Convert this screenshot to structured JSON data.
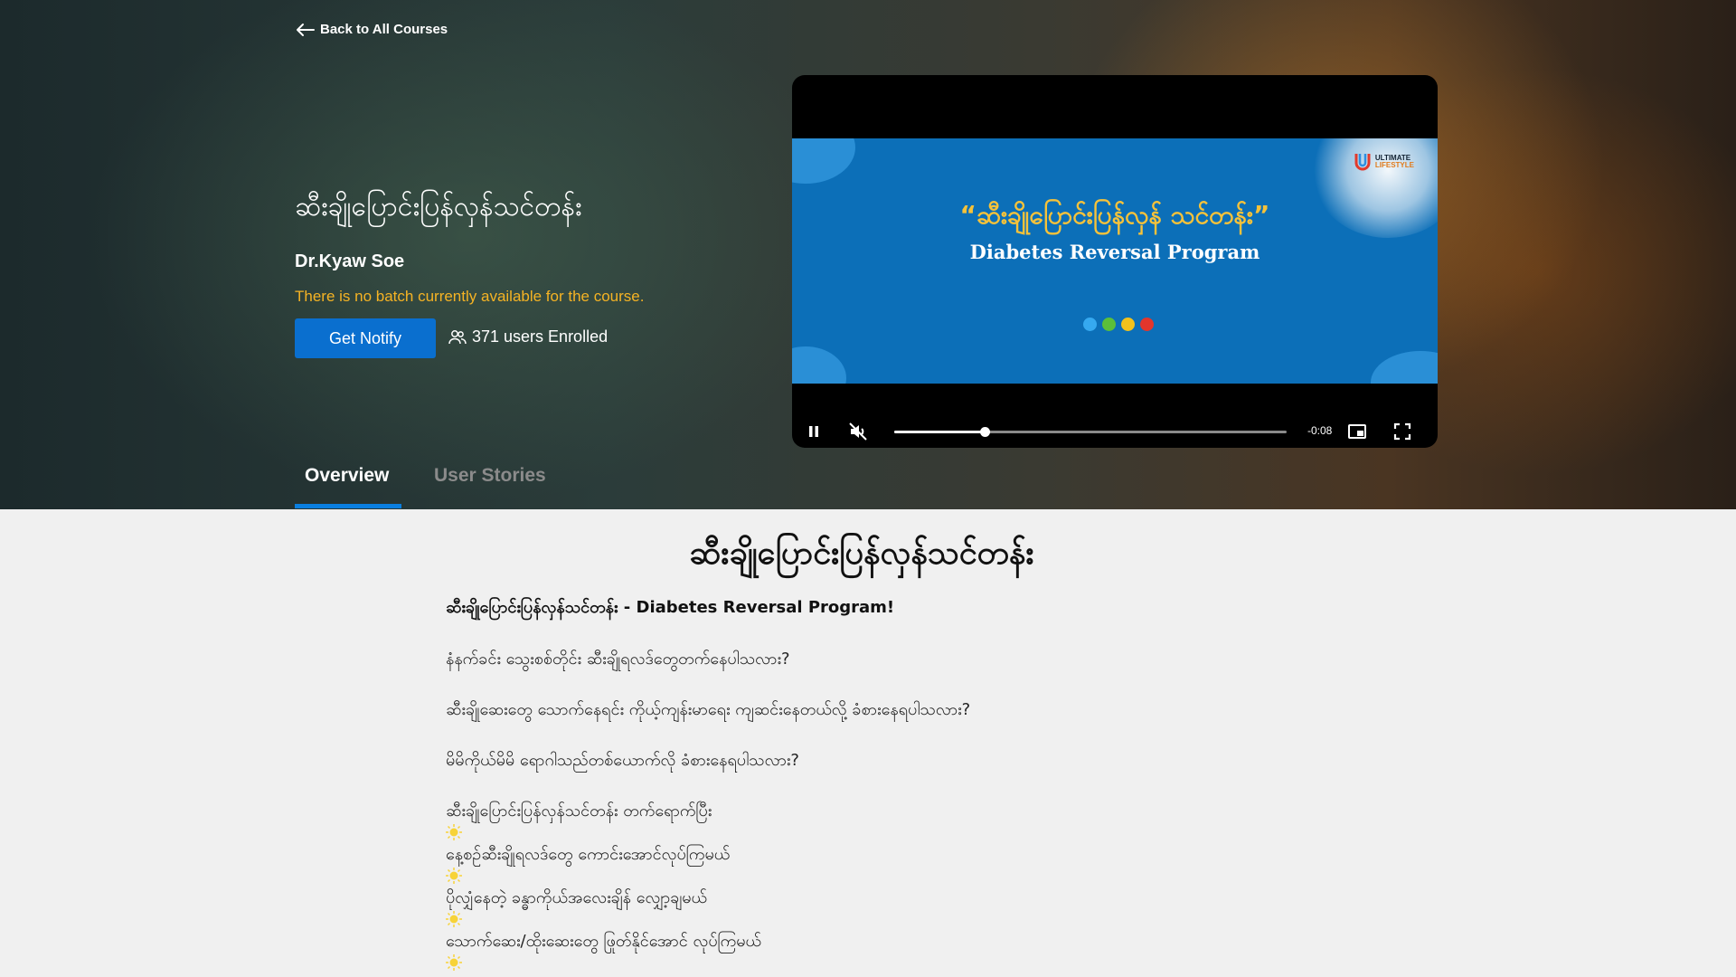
{
  "header": {
    "back_label": "Back to All Courses"
  },
  "course": {
    "title": "ဆီးချိုပြောင်းပြန်လှန်သင်တန်း",
    "instructor": "Dr.Kyaw Soe",
    "batch_note": "There is no batch currently available for the course.",
    "notify_label": "Get Notify",
    "enrolled_text": "371 users Enrolled"
  },
  "video": {
    "slide_title_my": "“ဆီးချိုပြောင်းပြန်လှန် သင်တန်း”",
    "slide_title_en": "Diabetes Reversal Program",
    "logo_text_top": "ULTIMATE",
    "logo_text_bottom": "LIFESTYLE",
    "time_remaining": "-0:08",
    "progress_fraction": 0.23,
    "dot_colors": [
      "#36a9f0",
      "#5bbf3a",
      "#f2c21b",
      "#e2362c"
    ]
  },
  "tabs": [
    {
      "label": "Overview",
      "active": true
    },
    {
      "label": "User Stories",
      "active": false
    }
  ],
  "content": {
    "heading": "ဆီးချိုပြောင်းပြန်လှန်သင်တန်း",
    "subtitle": "ဆီးချိုပြောင်းပြန်လှန်သင်တန်း - Diabetes Reversal Program!",
    "paragraphs": [
      "နံနက်ခင်း သွေးစစ်တိုင်း ဆီးချိုရလဒ်တွေတက်နေပါသလား?",
      "ဆီးချိုဆေးတွေ သောက်နေရင်း ကိုယ့်ကျန်းမာရေး ကျဆင်းနေတယ်လို့ ခံစားနေရပါသလား?",
      "မိမိကိုယ်မိမိ ရောဂါသည်တစ်ယောက်လို ခံစားနေရပါသလား?"
    ],
    "intro_line": "ဆီးချိုပြောင်းပြန်လှန်သင်တန်း တက်ရောက်ပြီး",
    "bullets": [
      "နေ့စဉ်ဆီးချိုရလဒ်တွေ ကောင်းအောင်လုပ်ကြမယ်",
      "ပိုလျှံနေတဲ့ ခန္ဓာကိုယ်အလေးချိန် လျှော့ချမယ်",
      "သောက်ဆေး/ထိုးဆေးတွေ ဖြုတ်နိုင်အောင် လုပ်ကြမယ်"
    ]
  },
  "colors": {
    "accent": "#0a6fcf",
    "warning": "#f5b324",
    "tab_underline": "#0a7fe0"
  }
}
